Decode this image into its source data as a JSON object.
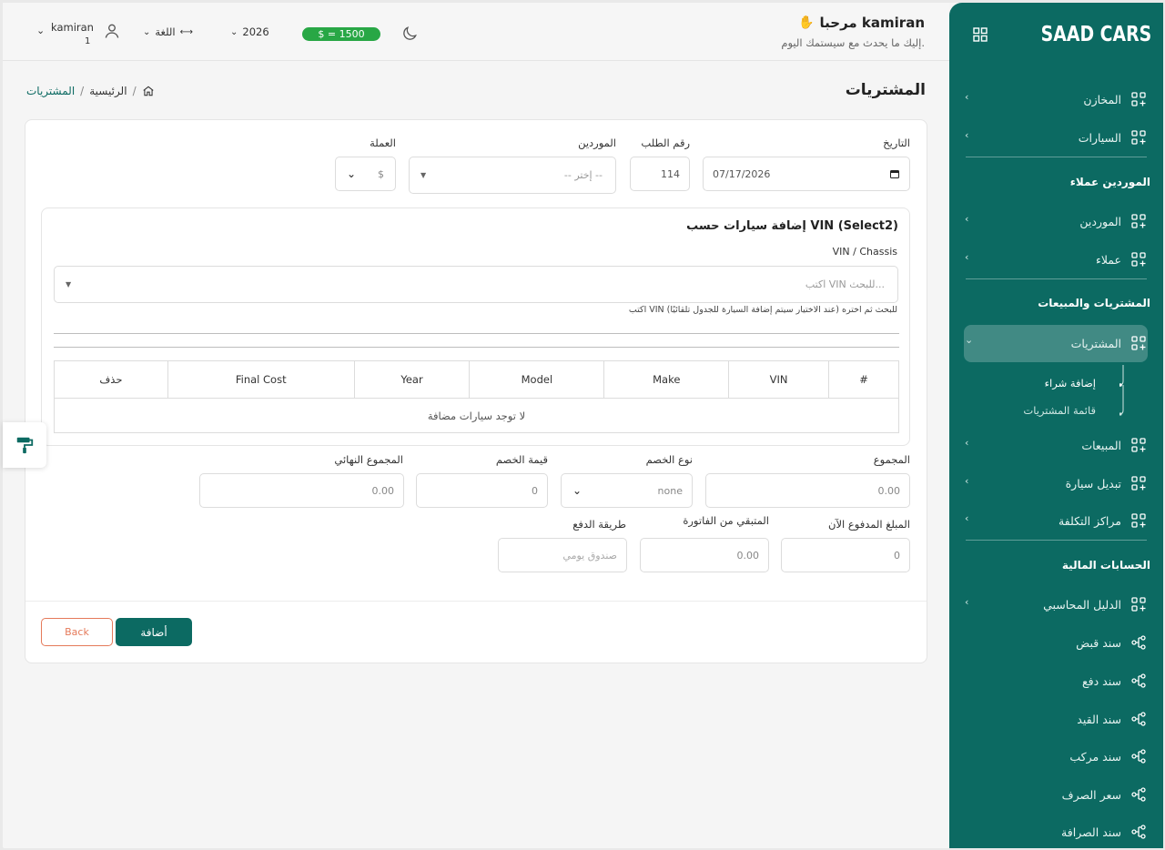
{
  "sidebar": {
    "brand": "SAAD CARS",
    "items_top": [
      {
        "label": "المخازن"
      },
      {
        "label": "السيارات"
      }
    ],
    "section_suppliers": "الموردين عملاء",
    "items_suppliers": [
      {
        "label": "الموردين"
      },
      {
        "label": "عملاء"
      }
    ],
    "section_trade": "المشتريات والمبيعات",
    "active_item": "المشتريات",
    "sub_items": [
      {
        "label": "إضافة شراء"
      },
      {
        "label": "قائمة المشتريات"
      }
    ],
    "items_trade": [
      {
        "label": "المبيعات"
      },
      {
        "label": "تبديل سيارة"
      },
      {
        "label": "مراكز التكلفة"
      }
    ],
    "section_finance": "الحسابات المالية",
    "finance_tree": "الدليل المحاسبي",
    "items_finance": [
      {
        "label": "سند قبض"
      },
      {
        "label": "سند دفع"
      },
      {
        "label": "سند القيد"
      },
      {
        "label": "سند مركب"
      },
      {
        "label": "سعر الصرف"
      },
      {
        "label": "سند الصرافة"
      }
    ]
  },
  "header": {
    "welcome": "مرحبا kamiran",
    "welcome_sub": "إليك ما يحدث مع سيستمك اليوم.",
    "rate": "$ = 1500",
    "year": "2026",
    "language": "اللغة",
    "user_name": "kamiran",
    "user_num": "1"
  },
  "page": {
    "title": "المشتريات",
    "breadcrumb_home": "الرئيسية",
    "breadcrumb_current": "المشتريات"
  },
  "form": {
    "date_label": "التاريخ",
    "date_value": "07/17/2026",
    "order_label": "رقم الطلب",
    "order_value": "114",
    "supplier_label": "الموردين",
    "supplier_placeholder": "-- إختر --",
    "currency_label": "العملة",
    "currency_value": "$",
    "vin_section_title": "إضافة سيارات حسب VIN (Select2)",
    "vin_label": "VIN / Chassis",
    "vin_placeholder": "اكتب VIN للبحث...",
    "vin_help": "اكتب VIN للبحث ثم اختره (عند الاختيار سيتم إضافة السيارة للجدول تلقائيًا)",
    "table_headers": [
      "#",
      "VIN",
      "Make",
      "Model",
      "Year",
      "Final Cost",
      "حذف"
    ],
    "table_empty": "لا توجد سيارات مضافة",
    "total_label": "المجموع",
    "total_value": "0.00",
    "discount_type_label": "نوع الخصم",
    "discount_type_value": "none",
    "discount_value_label": "قيمة الخصم",
    "discount_value": "0",
    "grand_total_label": "المجموع النهائي",
    "grand_total_value": "0.00",
    "paid_label": "المبلغ المدفوع الآن",
    "paid_value": "0",
    "remaining_label": "المتبقي من الفاتورة",
    "remaining_value": "0.00",
    "payment_method_label": "طريقة الدفع",
    "payment_method_placeholder": "صندوق يومي",
    "add_button": "أضافة",
    "back_button": "Back"
  },
  "colors": {
    "brand": "#0c6a62",
    "success": "#28a745",
    "danger_outline": "#e57a5a"
  }
}
